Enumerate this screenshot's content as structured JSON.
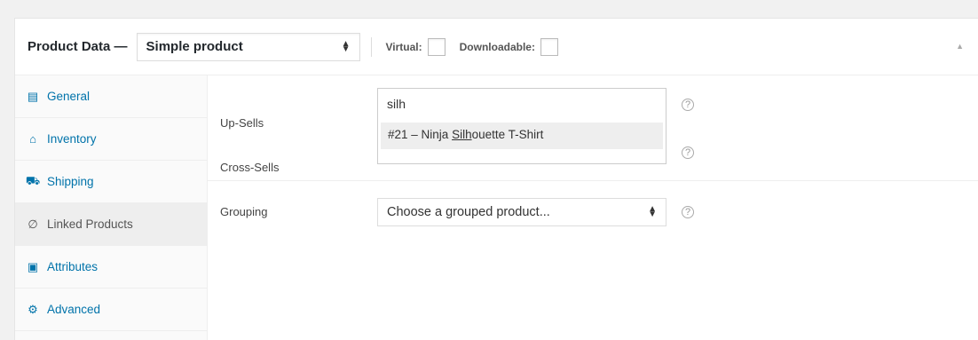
{
  "header": {
    "title": "Product Data —",
    "product_type": "Simple product",
    "virtual_label": "Virtual:",
    "downloadable_label": "Downloadable:",
    "collapse_icon": "▲"
  },
  "tabs": [
    {
      "label": "General",
      "icon": "▤",
      "active": false
    },
    {
      "label": "Inventory",
      "icon": "⌂",
      "active": false
    },
    {
      "label": "Shipping",
      "icon": "⛟",
      "active": false
    },
    {
      "label": "Linked Products",
      "icon": "∅",
      "active": true
    },
    {
      "label": "Attributes",
      "icon": "▣",
      "active": false
    },
    {
      "label": "Advanced",
      "icon": "⚙",
      "active": false
    }
  ],
  "linked": {
    "upsells_label": "Up-Sells",
    "upsells_value": "silh",
    "suggestion_prefix": "#21 – Ninja ",
    "suggestion_match": "Silh",
    "suggestion_suffix": "ouette T-Shirt",
    "crosssells_label": "Cross-Sells",
    "grouping_label": "Grouping",
    "grouping_value": "Choose a grouped product...",
    "help_glyph": "?"
  },
  "colors": {
    "link": "#0073aa",
    "active_tab_bg": "#eeeeee"
  }
}
